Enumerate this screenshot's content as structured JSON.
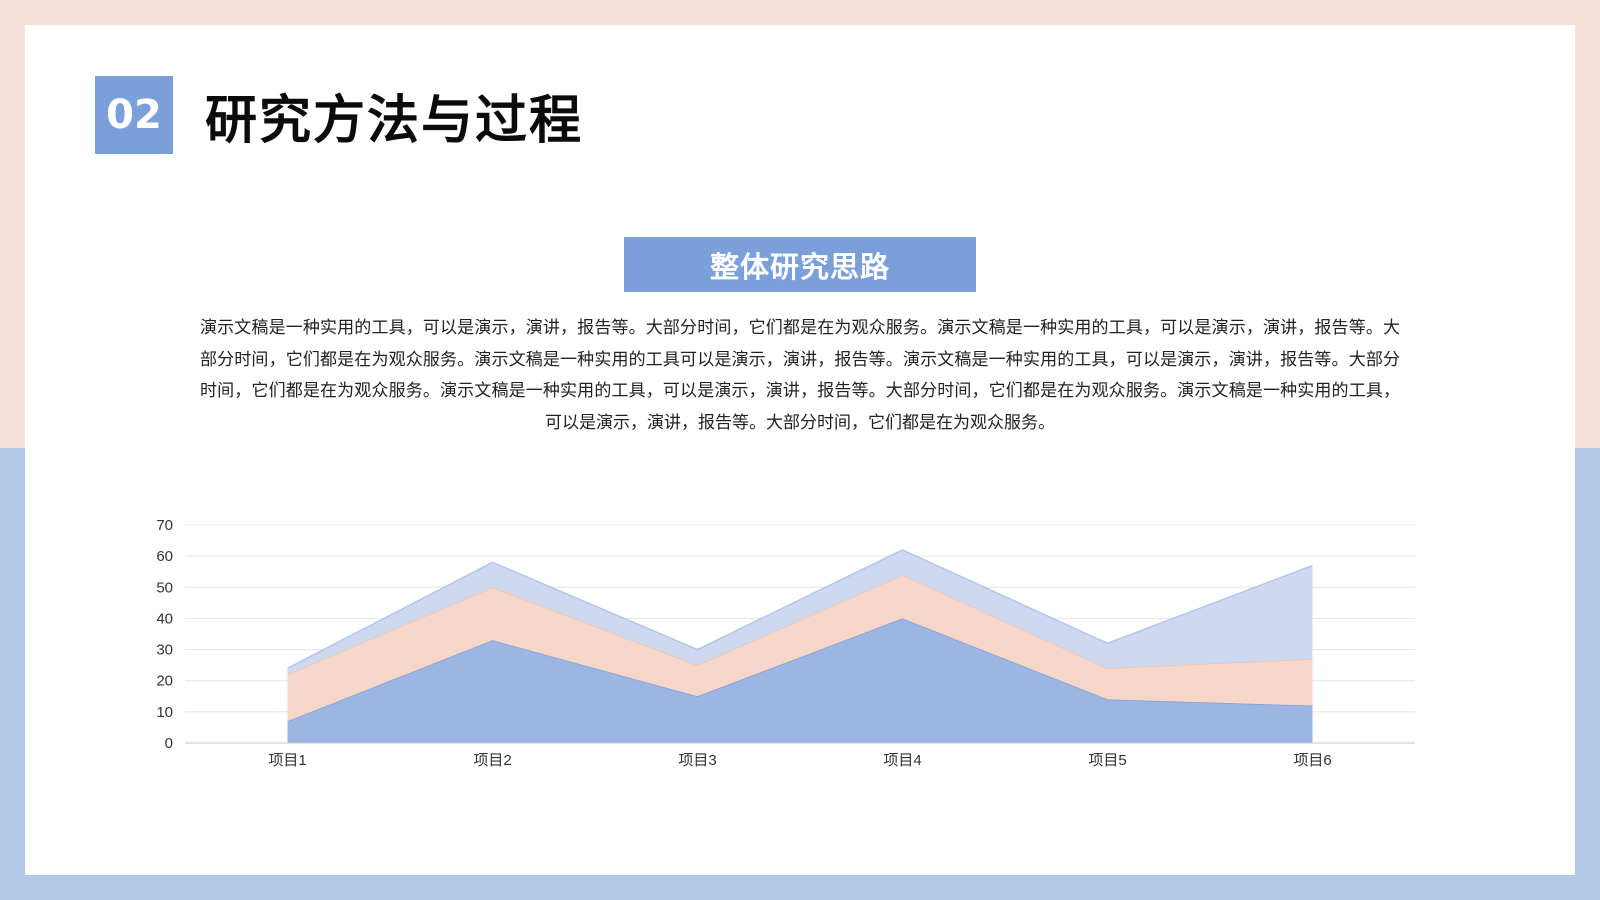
{
  "slide": {
    "section_number": "02",
    "title": "研究方法与过程",
    "section_heading": "整体研究思路",
    "body": "演示文稿是一种实用的工具，可以是演示，演讲，报告等。大部分时间，它们都是在为观众服务。演示文稿是一种实用的工具，可以是演示，演讲，报告等。大部分时间，它们都是在为观众服务。演示文稿是一种实用的工具可以是演示，演讲，报告等。演示文稿是一种实用的工具，可以是演示，演讲，报告等。大部分时间，它们都是在为观众服务。演示文稿是一种实用的工具，可以是演示，演讲，报告等。大部分时间，它们都是在为观众服务。演示文稿是一种实用的工具，可以是演示，演讲，报告等。大部分时间，它们都是在为观众服务。"
  },
  "colors": {
    "accent_blue": "#7a9fd9",
    "peach_bg": "#f6e2d9",
    "light_blue_bg": "#b4c8e8"
  },
  "chart_data": {
    "type": "area",
    "stacked": true,
    "categories": [
      "项目1",
      "项目2",
      "项目3",
      "项目4",
      "项目5",
      "项目6"
    ],
    "series": [
      {
        "name": "",
        "values": [
          7,
          33,
          15,
          40,
          14,
          12
        ],
        "color": "#9db5e3",
        "stroke": "#7f9fd8"
      },
      {
        "name": "",
        "values": [
          15,
          17,
          10,
          14,
          10,
          15
        ],
        "color": "#f5d6c8",
        "stroke": "#efc3ad"
      },
      {
        "name": "",
        "values": [
          2,
          8,
          5,
          8,
          8,
          30
        ],
        "color": "#cdd9f1",
        "stroke": "#b2c6ea"
      }
    ],
    "yticks": [
      0,
      10,
      20,
      30,
      40,
      50,
      60,
      70
    ],
    "ylim": [
      0,
      70
    ],
    "grid": true,
    "legend": "none"
  }
}
